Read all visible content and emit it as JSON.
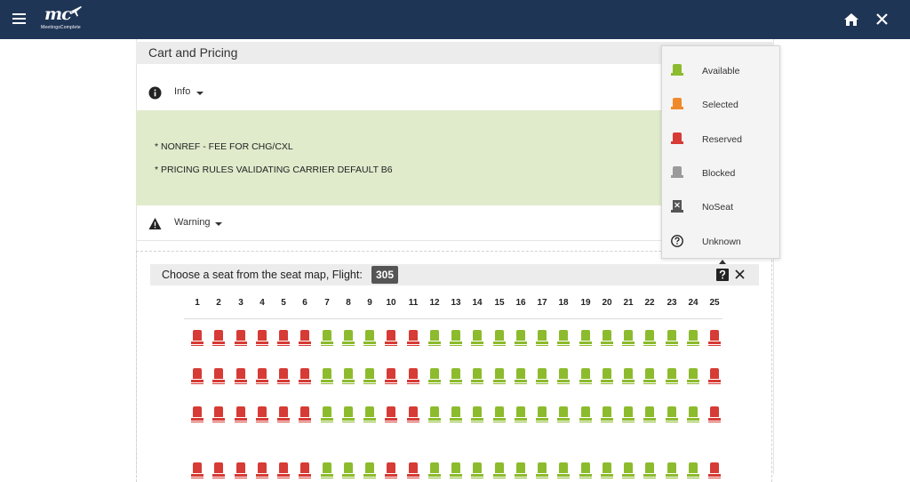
{
  "app": {
    "logo_mark": "mc",
    "logo_text": "MeetingsComplete"
  },
  "section": {
    "title": "Cart and Pricing"
  },
  "info": {
    "label": "Info",
    "lines": [
      "* NONREF - FEE FOR CHG/CXL",
      "* PRICING RULES VALIDATING CARRIER DEFAULT B6"
    ]
  },
  "warning": {
    "label": "Warning"
  },
  "seatmap": {
    "prompt": "Choose a seat from the seat map, Flight:",
    "flight": "305",
    "columns": [
      "1",
      "2",
      "3",
      "4",
      "5",
      "6",
      "7",
      "8",
      "9",
      "10",
      "11",
      "12",
      "13",
      "14",
      "15",
      "16",
      "17",
      "18",
      "19",
      "20",
      "21",
      "22",
      "23",
      "24",
      "25"
    ],
    "rows": [
      [
        "reserved",
        "reserved",
        "reserved",
        "reserved",
        "reserved",
        "reserved",
        "available",
        "available",
        "available",
        "reserved",
        "reserved",
        "available",
        "available",
        "available",
        "available",
        "available",
        "available",
        "available",
        "available",
        "available",
        "available",
        "available",
        "available",
        "available",
        "reserved"
      ],
      [
        "reserved",
        "reserved",
        "reserved",
        "reserved",
        "reserved",
        "reserved",
        "available",
        "available",
        "available",
        "reserved",
        "reserved",
        "available",
        "available",
        "available",
        "available",
        "available",
        "available",
        "available",
        "available",
        "available",
        "available",
        "available",
        "available",
        "available",
        "reserved"
      ],
      [
        "reserved",
        "reserved",
        "reserved",
        "reserved",
        "reserved",
        "reserved",
        "available",
        "available",
        "available",
        "reserved",
        "reserved",
        "available",
        "available",
        "available",
        "available",
        "available",
        "available",
        "available",
        "available",
        "available",
        "available",
        "available",
        "available",
        "available",
        "reserved"
      ],
      [
        "reserved",
        "reserved",
        "reserved",
        "reserved",
        "reserved",
        "reserved",
        "available",
        "available",
        "available",
        "reserved",
        "reserved",
        "available",
        "available",
        "available",
        "available",
        "available",
        "available",
        "available",
        "available",
        "available",
        "available",
        "available",
        "available",
        "available",
        "reserved"
      ]
    ]
  },
  "legend": {
    "items": [
      {
        "label": "Available",
        "icon": "seat-available-icon",
        "color": "#8dbb2e"
      },
      {
        "label": "Selected",
        "icon": "seat-selected-icon",
        "color": "#ef8a2c"
      },
      {
        "label": "Reserved",
        "icon": "seat-reserved-icon",
        "color": "#d63b35"
      },
      {
        "label": "Blocked",
        "icon": "seat-blocked-icon",
        "color": "#9b9b9b"
      },
      {
        "label": "NoSeat",
        "icon": "noseat-icon",
        "color": "#555555"
      },
      {
        "label": "Unknown",
        "icon": "question-circle-icon",
        "color": "#333333"
      }
    ]
  },
  "colors": {
    "topbar": "#1f3556",
    "info_box": "#e0ebcc",
    "available": "#8dbb2e",
    "reserved": "#d63b35"
  }
}
